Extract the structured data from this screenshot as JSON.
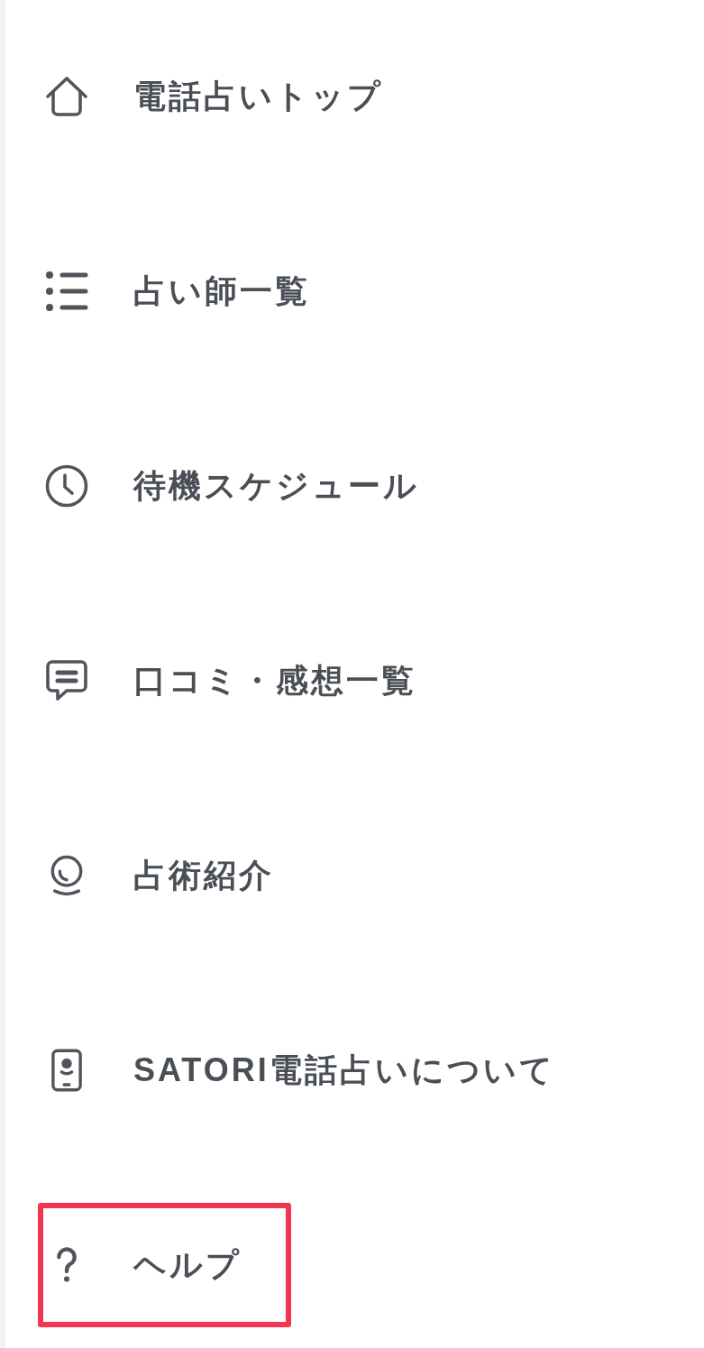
{
  "menu": {
    "items": [
      {
        "label": "電話占いトップ",
        "highlighted": false
      },
      {
        "label": "占い師一覧",
        "highlighted": false
      },
      {
        "label": "待機スケジュール",
        "highlighted": false
      },
      {
        "label": "口コミ・感想一覧",
        "highlighted": false
      },
      {
        "label": "占術紹介",
        "highlighted": false
      },
      {
        "label": "SATORI電話占いについて",
        "highlighted": false
      },
      {
        "label": "ヘルプ",
        "highlighted": true
      }
    ]
  }
}
